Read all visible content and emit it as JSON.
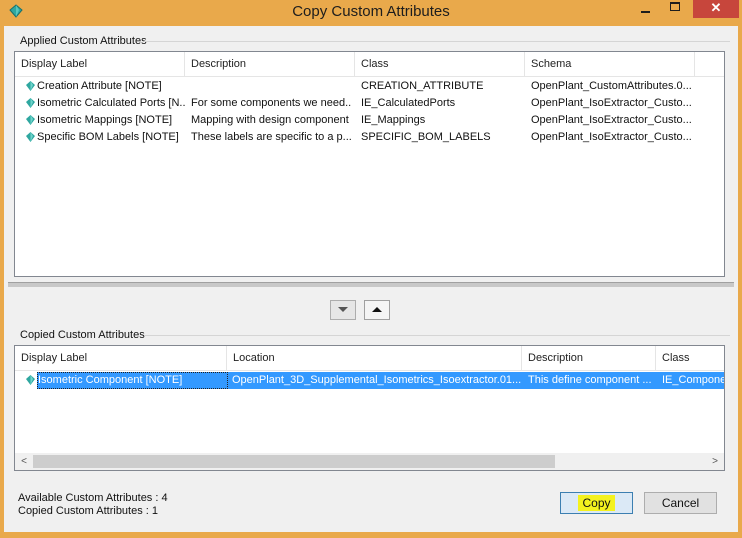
{
  "window": {
    "title": "Copy Custom Attributes"
  },
  "applied": {
    "group_label": "Applied Custom Attributes",
    "columns": [
      "Display Label",
      "Description",
      "Class",
      "Schema"
    ],
    "rows": [
      {
        "label": "Creation Attribute [NOTE]",
        "description": "",
        "class": "CREATION_ATTRIBUTE",
        "schema": "OpenPlant_CustomAttributes.0..."
      },
      {
        "label": "Isometric Calculated Ports [N...",
        "description": "For some components we need...",
        "class": "IE_CalculatedPorts",
        "schema": "OpenPlant_IsoExtractor_Custo..."
      },
      {
        "label": "Isometric Mappings [NOTE]",
        "description": "Mapping with design component",
        "class": "IE_Mappings",
        "schema": "OpenPlant_IsoExtractor_Custo..."
      },
      {
        "label": "Specific BOM Labels [NOTE]",
        "description": "These labels are specific to a p...",
        "class": "SPECIFIC_BOM_LABELS",
        "schema": "OpenPlant_IsoExtractor_Custo..."
      }
    ]
  },
  "copied": {
    "group_label": "Copied Custom Attributes",
    "columns": [
      "Display Label",
      "Location",
      "Description",
      "Class"
    ],
    "rows": [
      {
        "label": "Isometric Component [NOTE]",
        "location": "OpenPlant_3D_Supplemental_Isometrics_Isoextractor.01....",
        "description": "This define component ...",
        "class": "IE_Compone"
      }
    ]
  },
  "status": {
    "available": "Available Custom Attributes : 4",
    "copied": "Copied Custom Attributes : 1"
  },
  "buttons": {
    "copy": "Copy",
    "cancel": "Cancel"
  },
  "icons": {
    "window": "gem-icon",
    "row": "gem-icon",
    "down": "triangle-down-icon",
    "up": "triangle-up-icon"
  },
  "colors": {
    "frame": "#e9a94b",
    "close": "#c7463c",
    "selection": "#3399ff",
    "copy_highlight": "#f4f21f"
  }
}
